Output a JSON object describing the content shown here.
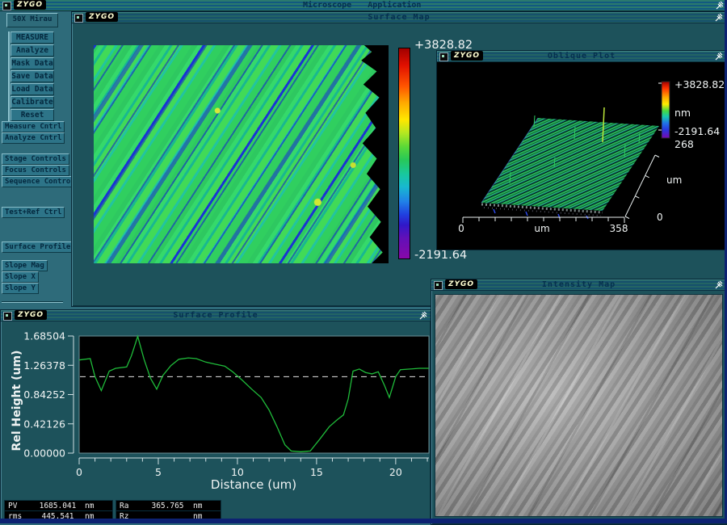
{
  "brand": {
    "logo_text": "ZYGO"
  },
  "topbar": {
    "menu": [
      {
        "label": "Microscope"
      },
      {
        "label": "Application"
      }
    ]
  },
  "sidebar": {
    "objective_label": "50X Mirau",
    "main_buttons": [
      {
        "label": "MEASURE"
      },
      {
        "label": "Analyze"
      },
      {
        "label": "Mask Data"
      },
      {
        "label": "Save Data"
      },
      {
        "label": "Load Data"
      },
      {
        "label": "Calibrate"
      },
      {
        "label": "Reset"
      }
    ],
    "control_buttons": [
      {
        "label": "Measure Cntrl"
      },
      {
        "label": "Analyze Cntrl"
      },
      {
        "label": "Stage Controls"
      },
      {
        "label": "Focus Controls"
      },
      {
        "label": "Sequence Contro."
      },
      {
        "label": "Test+Ref Ctrl"
      },
      {
        "label": "Surface Profile"
      },
      {
        "label": "Slope Mag"
      },
      {
        "label": "Slope X"
      },
      {
        "label": "Slope Y"
      }
    ]
  },
  "surface_map": {
    "title": "Surface Map",
    "colorbar": {
      "max": "+3828.82",
      "min": "-2191.64"
    }
  },
  "oblique_plot": {
    "title": "Oblique Plot",
    "colorbar": {
      "max": "+3828.82",
      "unit": "nm",
      "min": "-2191.64",
      "depth": "268"
    },
    "x_axis": {
      "min": "0",
      "unit": "um",
      "max": "358"
    },
    "z_axis": {
      "unit": "um",
      "min": "0"
    }
  },
  "intensity_map": {
    "title": "Intensity Map"
  },
  "surface_profile": {
    "title": "Surface Profile",
    "ylabel": "Rel Height (um)",
    "xlabel": "Distance (um)",
    "yticks": [
      "1.68504",
      "1.26378",
      "0.84252",
      "0.42126",
      "0.00000"
    ],
    "xticks": [
      "0",
      "5",
      "10",
      "15",
      "20"
    ]
  },
  "results": {
    "boxes": [
      {
        "label": "PV",
        "value": "1685.041",
        "unit": "nm"
      },
      {
        "label": "Ra",
        "value": "365.765",
        "unit": "nm"
      },
      {
        "label": "rms",
        "value": "445.541",
        "unit": "nm"
      },
      {
        "label": "Rz",
        "value": "",
        "unit": "nm"
      }
    ]
  },
  "colors": {
    "desktop": "#2e6b7a",
    "titlebar": "#1d6384",
    "profile_line": "#1fbb3a",
    "scale_top": "#a00000",
    "scale_bottom": "#8808a8"
  },
  "chart_data": {
    "type": "line",
    "title": "Surface Profile",
    "xlabel": "Distance (um)",
    "ylabel": "Rel Height (um)",
    "xlim": [
      0,
      22.1
    ],
    "ylim": [
      0,
      1.68504
    ],
    "yticks": [
      1.68504,
      1.26378,
      0.84252,
      0.42126,
      0.0
    ],
    "xticks": [
      0,
      5,
      10,
      15,
      20
    ],
    "mean_line": 1.1,
    "grid": false,
    "x": [
      0,
      0.7,
      1.0,
      1.4,
      1.9,
      2.3,
      3.0,
      3.3,
      3.7,
      4.1,
      4.5,
      4.9,
      5.3,
      5.8,
      6.3,
      6.9,
      7.4,
      8.0,
      8.6,
      9.2,
      9.7,
      10.3,
      10.9,
      11.5,
      12.0,
      12.5,
      13.0,
      13.4,
      14.0,
      14.6,
      15.2,
      15.8,
      16.3,
      16.7,
      17.0,
      17.3,
      17.7,
      18.1,
      18.5,
      18.9,
      19.3,
      19.6,
      20.0,
      20.3,
      20.9,
      21.5,
      22.1
    ],
    "y": [
      1.34,
      1.36,
      1.1,
      0.9,
      1.18,
      1.22,
      1.24,
      1.4,
      1.68,
      1.35,
      1.08,
      0.92,
      1.12,
      1.26,
      1.35,
      1.37,
      1.36,
      1.31,
      1.28,
      1.25,
      1.17,
      1.05,
      0.92,
      0.8,
      0.62,
      0.38,
      0.12,
      0.03,
      0.02,
      0.03,
      0.2,
      0.38,
      0.48,
      0.55,
      0.78,
      1.18,
      1.21,
      1.16,
      1.14,
      1.17,
      0.97,
      0.8,
      1.1,
      1.2,
      1.21,
      1.22,
      1.22
    ]
  }
}
